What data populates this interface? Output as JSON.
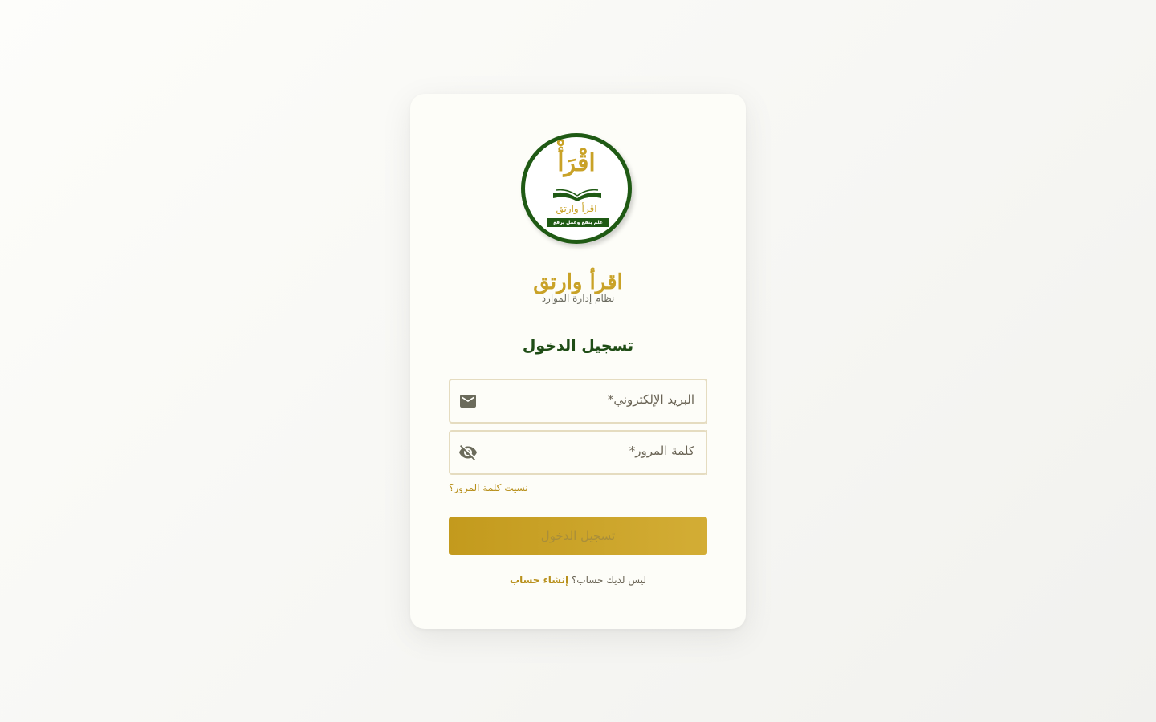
{
  "logo": {
    "main_text": "اقْرَأْ",
    "sub_text": "اقرأ وارتق",
    "banner_text": "علم ينفع وعمل يرفع"
  },
  "brand": {
    "title": "اقرأ وارتق",
    "subtitle": "نظام إدارة الموارد"
  },
  "form": {
    "heading": "تسجيل الدخول",
    "email_label": "البريد الإلكتروني*",
    "email_icon": "mail-icon",
    "password_label": "كلمة المرور*",
    "password_icon": "eye-off-icon",
    "forgot_password": "نسيت كلمة المرور؟",
    "submit_label": "تسجيل الدخول"
  },
  "signup": {
    "prompt": "ليس لديك حساب؟",
    "link": "إنشاء حساب"
  },
  "colors": {
    "primary_green": "#1f5a14",
    "gold": "#c9a227",
    "field_border": "#e5dcc0"
  }
}
